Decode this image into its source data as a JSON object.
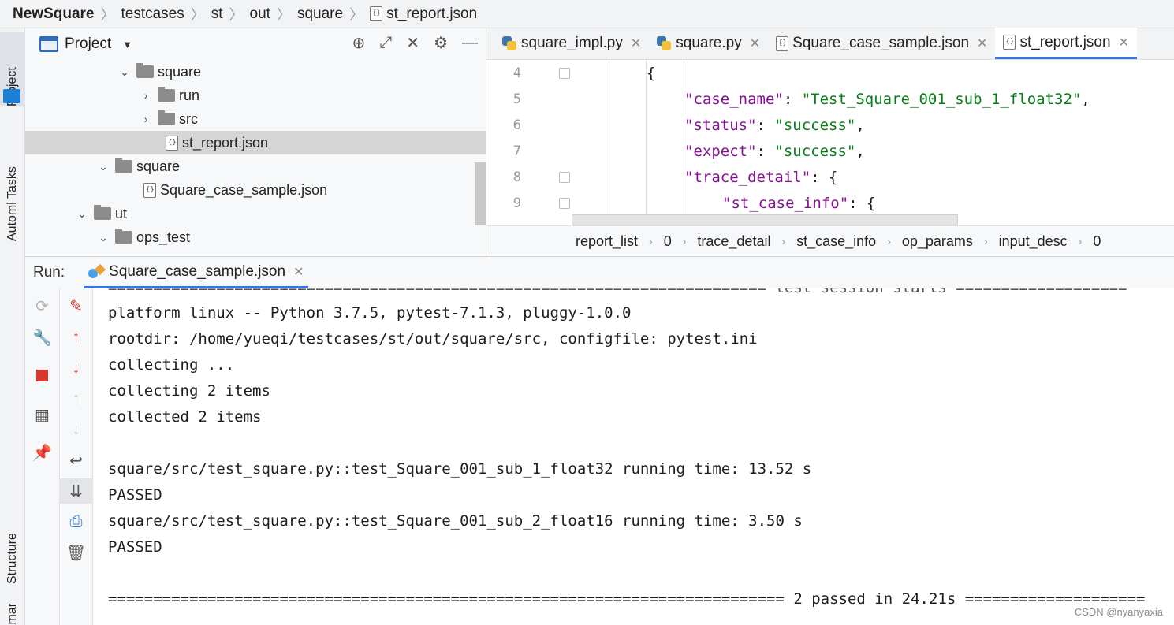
{
  "breadcrumb": [
    "NewSquare",
    "testcases",
    "st",
    "out",
    "square",
    "st_report.json"
  ],
  "left_strip": {
    "project": "Project",
    "automl": "Automl Tasks",
    "structure": "Structure",
    "bookmarks": "Bookmarks"
  },
  "project_panel": {
    "title": "Project",
    "tree": [
      {
        "label": "square",
        "type": "folder",
        "expanded": true
      },
      {
        "label": "run",
        "type": "folder",
        "expanded": false
      },
      {
        "label": "src",
        "type": "folder",
        "expanded": false
      },
      {
        "label": "st_report.json",
        "type": "json",
        "selected": true
      },
      {
        "label": "square",
        "type": "folder",
        "expanded": true
      },
      {
        "label": "Square_case_sample.json",
        "type": "json"
      },
      {
        "label": "ut",
        "type": "folder",
        "expanded": true
      },
      {
        "label": "ops_test",
        "type": "folder",
        "expanded": true
      }
    ]
  },
  "editor": {
    "tabs": [
      {
        "label": "square_impl.py",
        "icon": "python-icon",
        "active": false
      },
      {
        "label": "square.py",
        "icon": "python-icon",
        "active": false
      },
      {
        "label": "Square_case_sample.json",
        "icon": "json-icon",
        "active": false
      },
      {
        "label": "st_report.json",
        "icon": "json-icon",
        "active": true
      }
    ],
    "lines": [
      {
        "num": "4",
        "text": "{"
      },
      {
        "num": "5",
        "key": "\"case_name\"",
        "value": "\"Test_Square_001_sub_1_float32\"",
        "tail": ","
      },
      {
        "num": "6",
        "key": "\"status\"",
        "value": "\"success\"",
        "tail": ","
      },
      {
        "num": "7",
        "key": "\"expect\"",
        "value": "\"success\"",
        "tail": ","
      },
      {
        "num": "8",
        "key": "\"trace_detail\"",
        "value": "",
        "tail": " {"
      },
      {
        "num": "9",
        "key": "\"st_case_info\"",
        "value": "",
        "tail": " {"
      }
    ],
    "path": [
      "report_list",
      "0",
      "trace_detail",
      "st_case_info",
      "op_params",
      "input_desc",
      "0"
    ]
  },
  "run_panel": {
    "label": "Run:",
    "tab": "Square_case_sample.json",
    "console": [
      "========================================================================= test session starts ===================",
      "platform linux -- Python 3.7.5, pytest-7.1.3, pluggy-1.0.0",
      "rootdir: /home/yueqi/testcases/st/out/square/src, configfile: pytest.ini",
      "collecting ...",
      "collecting 2 items",
      "collected 2 items",
      "",
      "square/src/test_square.py::test_Square_001_sub_1_float32 running time: 13.52 s",
      "PASSED",
      "square/src/test_square.py::test_Square_001_sub_2_float16 running time: 3.50 s",
      "PASSED",
      "",
      "=========================================================================== 2 passed in 24.21s ===================="
    ],
    "watermark": "CSDN @nyanyaxia"
  },
  "colors": {
    "accent": "#3574f0",
    "json_key": "#871094",
    "json_string": "#067d17",
    "stop_red": "#d6372e"
  }
}
